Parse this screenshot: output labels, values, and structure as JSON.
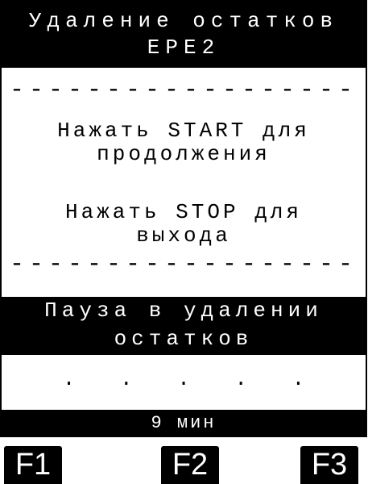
{
  "header": {
    "title_line1": "Удаление остатков",
    "title_line2": "EPE2"
  },
  "message": {
    "separator": "------------------",
    "start_line1": "Нажать START для",
    "start_line2": "продолжения",
    "stop_line1": "Нажать STOP для",
    "stop_line2": "выхода"
  },
  "status": {
    "line1": "Пауза в удалении",
    "line2": "остатков",
    "progress_dots": ". . . . ."
  },
  "timer": {
    "text": "9 мин"
  },
  "function_keys": {
    "f1": "F1",
    "f2": "F2",
    "f3": "F3"
  },
  "colors": {
    "background": "#ffffff",
    "bar": "#000000",
    "bar_text": "#ffffff"
  }
}
